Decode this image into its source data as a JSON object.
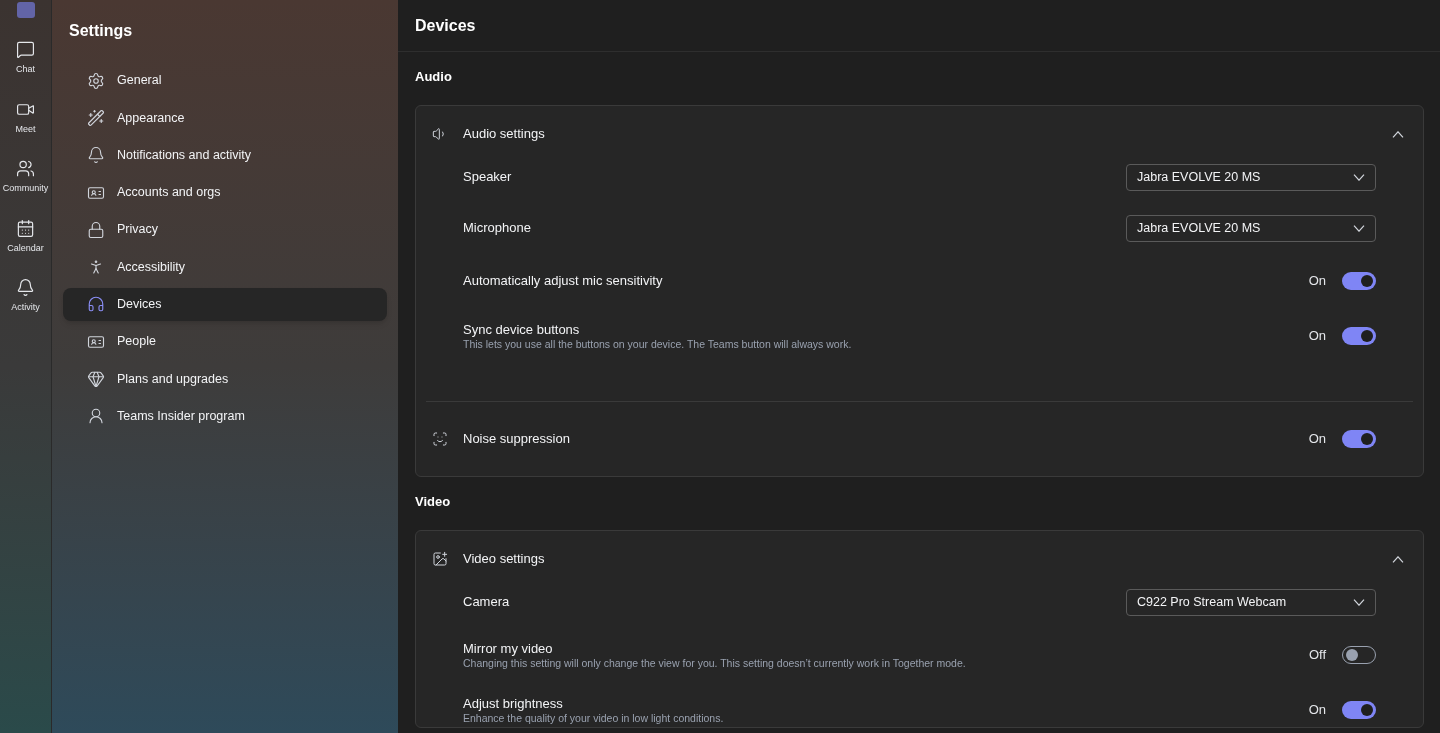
{
  "rail": [
    {
      "label": "Chat",
      "selected": false
    },
    {
      "label": "Meet",
      "selected": false
    },
    {
      "label": "Community",
      "selected": false
    },
    {
      "label": "Calendar",
      "selected": false
    },
    {
      "label": "Activity",
      "selected": false
    }
  ],
  "settings": {
    "title": "Settings",
    "items": [
      {
        "label": "General",
        "selected": false
      },
      {
        "label": "Appearance",
        "selected": false
      },
      {
        "label": "Notifications and activity",
        "selected": false
      },
      {
        "label": "Accounts and orgs",
        "selected": false
      },
      {
        "label": "Privacy",
        "selected": false
      },
      {
        "label": "Accessibility",
        "selected": false
      },
      {
        "label": "Devices",
        "selected": true
      },
      {
        "label": "People",
        "selected": false
      },
      {
        "label": "Plans and upgrades",
        "selected": false
      },
      {
        "label": "Teams Insider program",
        "selected": false
      }
    ]
  },
  "page": {
    "title": "Devices",
    "sections": [
      {
        "title": "Audio",
        "card": {
          "title": "Audio settings",
          "expanded": true,
          "rows": [
            {
              "kind": "select",
              "label": "Speaker",
              "value": "Jabra EVOLVE 20 MS"
            },
            {
              "kind": "select",
              "label": "Microphone",
              "value": "Jabra EVOLVE 20 MS"
            },
            {
              "kind": "toggle",
              "label": "Automatically adjust mic sensitivity",
              "on": true,
              "state_label": "On"
            },
            {
              "kind": "toggle",
              "label": "Sync device buttons",
              "description": "This lets you use all the buttons on your device. The Teams button will always work.",
              "on": true,
              "state_label": "On"
            }
          ],
          "extra": [
            {
              "label": "Noise suppression",
              "on": true,
              "state_label": "On"
            }
          ]
        }
      },
      {
        "title": "Video",
        "card": {
          "title": "Video settings",
          "expanded": true,
          "rows": [
            {
              "kind": "select",
              "label": "Camera",
              "value": "C922 Pro Stream Webcam"
            },
            {
              "kind": "toggle",
              "label": "Mirror my video",
              "description": "Changing this setting will only change the view for you. This setting doesn’t currently work in Together mode.",
              "on": false,
              "state_label": "Off"
            },
            {
              "kind": "toggle",
              "label": "Adjust brightness",
              "description": "Enhance the quality of your video in low light conditions.",
              "on": true,
              "state_label": "On"
            }
          ]
        }
      }
    ]
  }
}
